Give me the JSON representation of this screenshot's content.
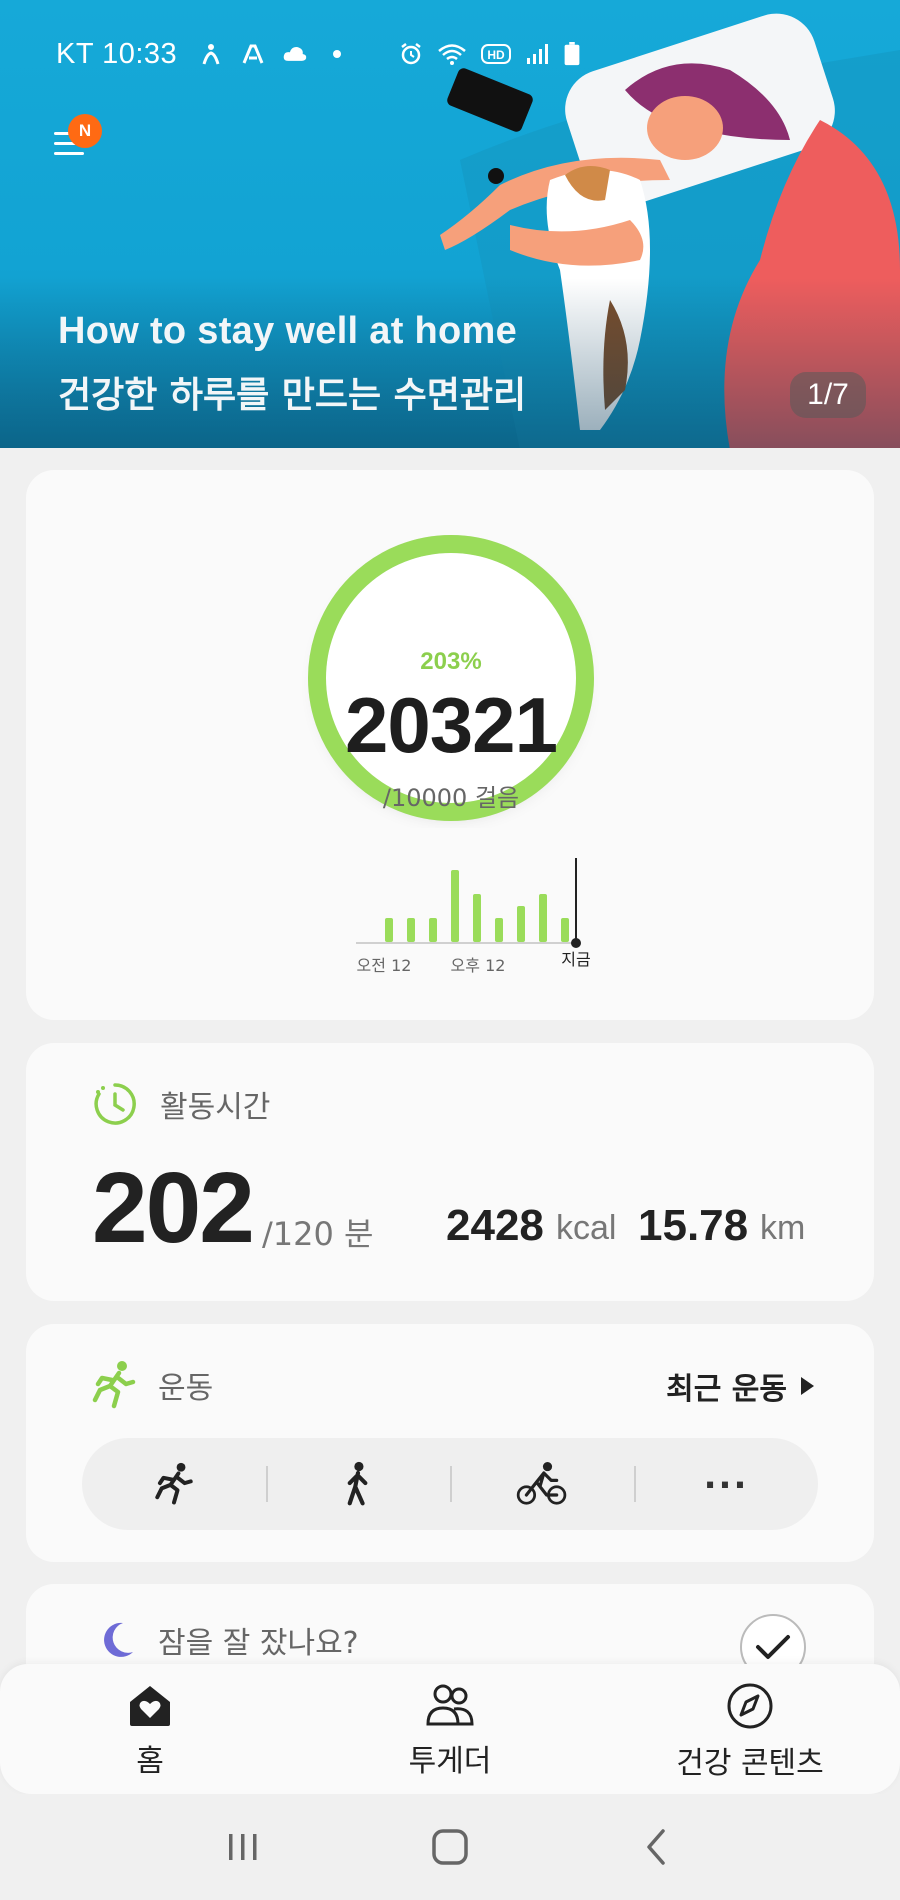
{
  "status_bar": {
    "carrier": "KT",
    "time": "10:33"
  },
  "hero": {
    "notification_badge": "N",
    "title": "How to stay well at home",
    "subtitle": "건강한 하루를 만드는 수면관리",
    "page_indicator": "1/7"
  },
  "steps": {
    "percent": "203%",
    "count": "20321",
    "goal": "/10000 걸음",
    "progress_fraction": 1.0,
    "accent_color": "#9adc5a"
  },
  "chart_data": {
    "type": "bar",
    "title": "",
    "xlabel": "",
    "ylabel": "",
    "x_tick_labels": [
      "오전 12",
      "오후 12",
      "지금"
    ],
    "values": [
      0,
      1,
      1,
      1,
      3,
      2,
      1,
      1.5,
      2,
      1
    ],
    "bar_color": "#9adc5a"
  },
  "activity": {
    "label": "활동시간",
    "minutes": "202",
    "goal": "/120 분",
    "kcal_value": "2428",
    "kcal_unit": "kcal",
    "distance_value": "15.78",
    "distance_unit": "km"
  },
  "exercise": {
    "label": "운동",
    "recent_link": "최근 운동",
    "more_label": "..."
  },
  "sleep": {
    "label": "잠을 잘 잤나요?"
  },
  "bottom_nav": {
    "items": [
      {
        "label": "홈",
        "icon": "home-heart-icon"
      },
      {
        "label": "투게더",
        "icon": "people-icon"
      },
      {
        "label": "건강 콘텐츠",
        "icon": "compass-icon"
      }
    ]
  }
}
